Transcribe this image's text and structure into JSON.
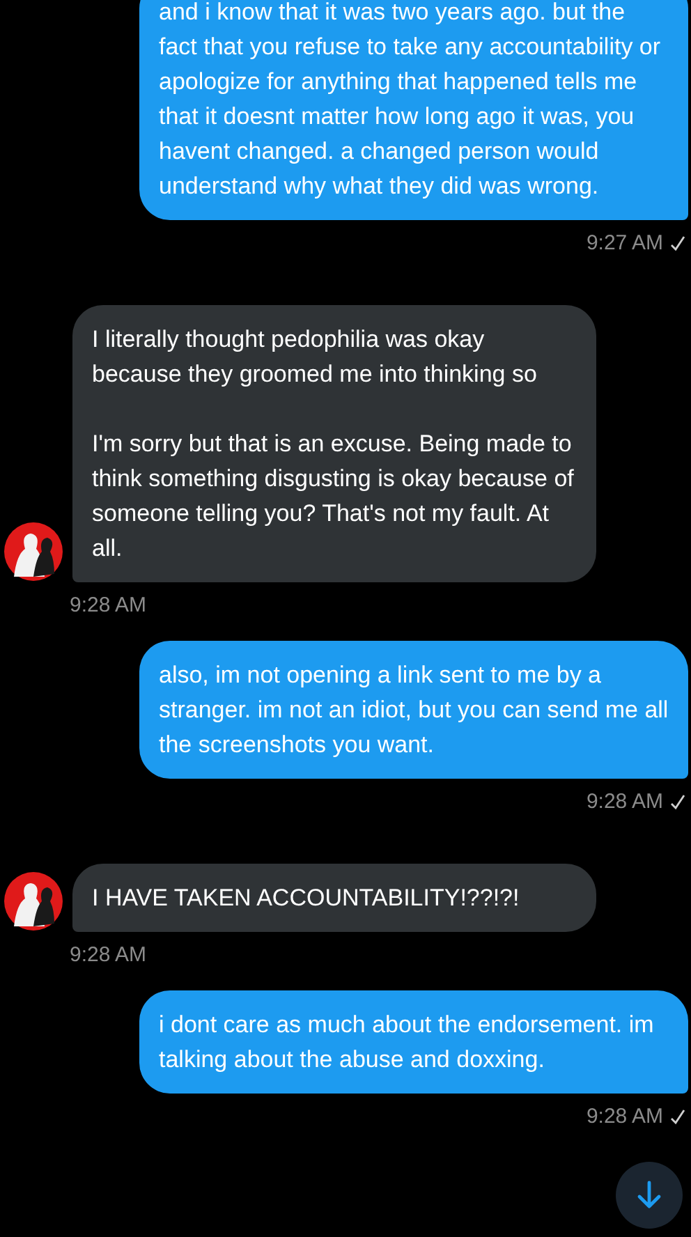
{
  "messages": [
    {
      "kind": "sent",
      "text": "and i know that it was two years ago. but the fact that you refuse to take any accountability or apologize for anything that happened tells me that it doesnt matter how long ago it was, you havent changed. a changed person would understand why what they did was wrong.",
      "time": "9:27 AM",
      "read": true
    },
    {
      "kind": "received",
      "text": "I literally thought pedophilia was okay because they groomed me into thinking so\n\nI'm sorry but that is an excuse. Being made to think something disgusting is okay because of someone telling you? That's not my fault. At all.",
      "time": "9:28 AM"
    },
    {
      "kind": "sent",
      "text": "also, im not opening a link sent to me by a stranger. im not an idiot, but you can send me all the screenshots you want.",
      "time": "9:28 AM",
      "read": true
    },
    {
      "kind": "received",
      "text": "I HAVE TAKEN ACCOUNTABILITY!??!?!",
      "time": "9:28 AM"
    },
    {
      "kind": "sent",
      "text": "i dont care as much about the endorsement. im talking about the abuse and doxxing.",
      "time": "9:28 AM",
      "read": true
    }
  ]
}
